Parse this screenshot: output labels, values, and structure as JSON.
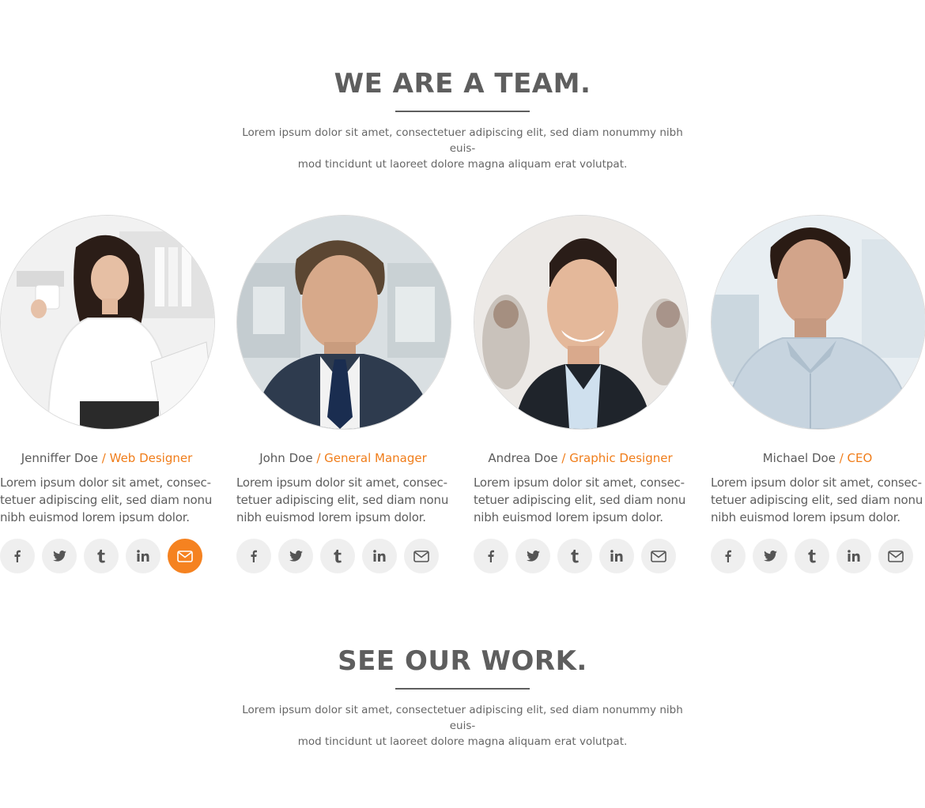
{
  "team_section": {
    "title": "WE ARE A TEAM.",
    "intro_line1": "Lorem ipsum dolor sit amet, consectetuer adipiscing elit, sed diam nonummy nibh euis-",
    "intro_line2": "mod tincidunt ut laoreet dolore magna aliquam erat volutpat."
  },
  "members": [
    {
      "name": "Jenniffer Doe",
      "role": "/ Web Designer",
      "bio": "Lorem ipsum dolor sit amet, consec-tetuer adipiscing elit, sed diam nonu nibh euismod lorem ipsum dolor.",
      "active_social": "email"
    },
    {
      "name": "John Doe",
      "role": "/ General Manager",
      "bio": "Lorem ipsum dolor sit amet, consec-tetuer adipiscing elit, sed diam nonu nibh euismod lorem ipsum dolor.",
      "active_social": ""
    },
    {
      "name": "Andrea Doe",
      "role": "/ Graphic Designer",
      "bio": "Lorem ipsum dolor sit amet, consec-tetuer adipiscing elit, sed diam nonu nibh euismod lorem ipsum dolor.",
      "active_social": ""
    },
    {
      "name": "Michael Doe",
      "role": "/ CEO",
      "bio": "Lorem ipsum dolor sit amet, consec-tetuer adipiscing elit, sed diam nonu nibh euismod lorem ipsum dolor.",
      "active_social": ""
    }
  ],
  "social_icons": [
    "facebook-icon",
    "twitter-icon",
    "tumblr-icon",
    "linkedin-icon",
    "email-icon"
  ],
  "work_section": {
    "title": "SEE OUR WORK.",
    "intro_line1": "Lorem ipsum dolor sit amet, consectetuer adipiscing elit, sed diam nonummy nibh euis-",
    "intro_line2": "mod tincidunt ut laoreet dolore magna aliquam erat volutpat."
  },
  "colors": {
    "accent": "#f58220",
    "role_text": "#f07d1a",
    "heading": "#5e5e5e",
    "social_bg": "#efefef"
  }
}
